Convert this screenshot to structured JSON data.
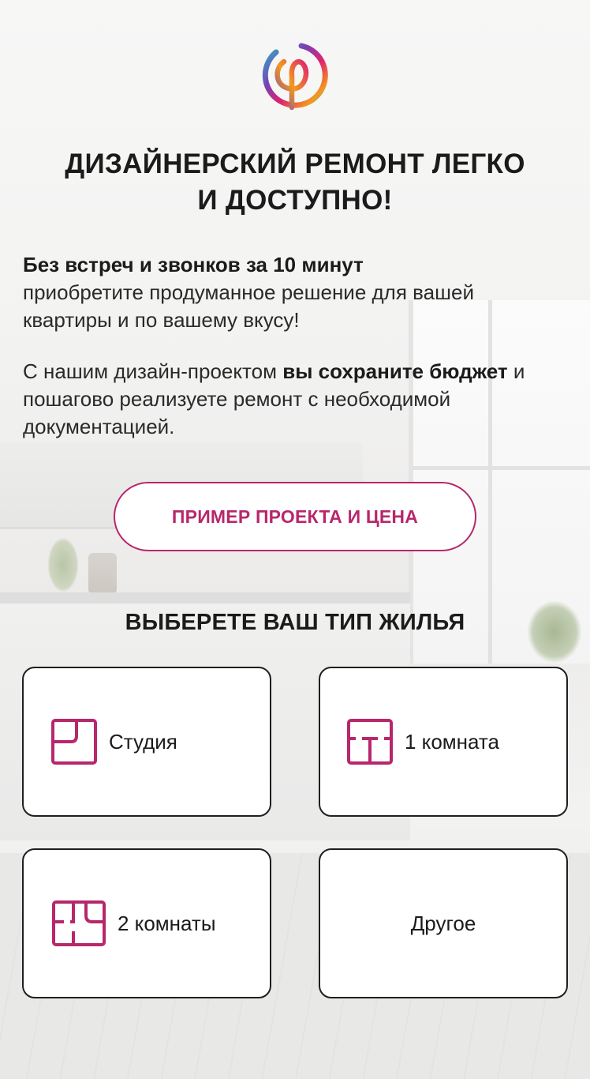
{
  "logo": {
    "icon": "brand-logo-icon"
  },
  "headline": {
    "line1": "ДИЗАЙНЕРСКИЙ РЕМОНТ ЛЕГКО",
    "line2": "И ДОСТУПНО!"
  },
  "intro": {
    "bold1": "Без встреч и звонков за 10 минут",
    "text1": "приобретите продуманное решение для вашей квартиры и по вашему вкусу!",
    "text2a": "С нашим дизайн-проектом ",
    "bold2": "вы сохраните бюджет",
    "text2b": " и пошагово реализуете ремонт с необходимой документацией."
  },
  "cta": {
    "label": "ПРИМЕР ПРОЕКТА И ЦЕНА"
  },
  "housing": {
    "title": "ВЫБЕРЕТЕ ВАШ ТИП ЖИЛЬЯ",
    "options": [
      {
        "label": "Студия",
        "icon": "studio-floorplan-icon"
      },
      {
        "label": "1 комната",
        "icon": "one-room-floorplan-icon"
      },
      {
        "label": "2 комнаты",
        "icon": "two-rooms-floorplan-icon"
      },
      {
        "label": "Другое",
        "icon": ""
      }
    ]
  },
  "colors": {
    "accent": "#b7276b",
    "text": "#1b1b1b",
    "card_border": "#1f1f1f"
  }
}
